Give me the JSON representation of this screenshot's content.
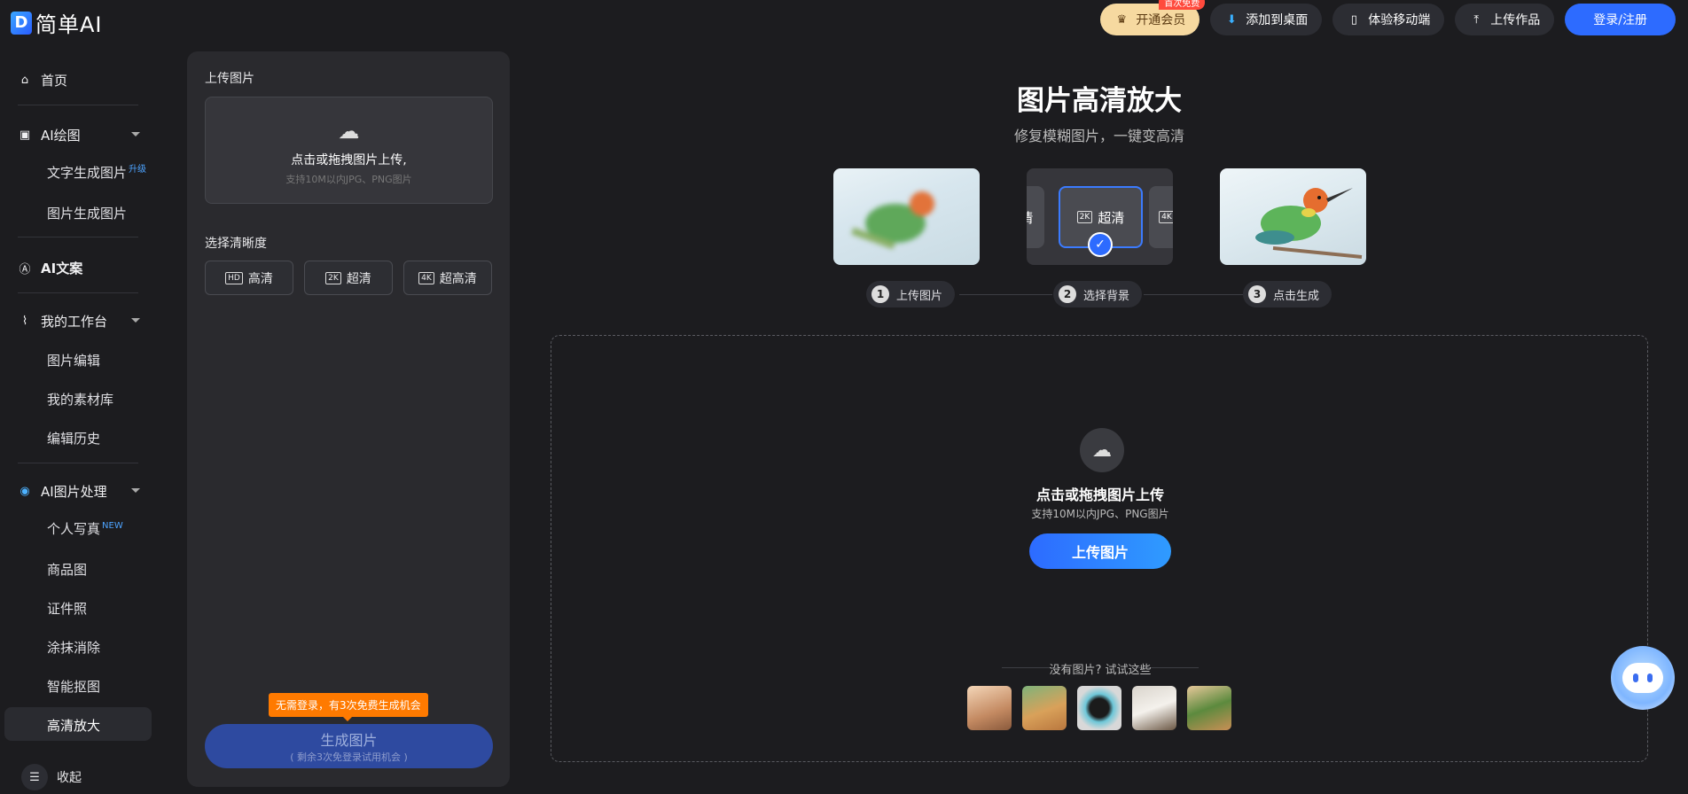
{
  "brand": {
    "logo_letter": "D",
    "name": "简单AI"
  },
  "top": {
    "vip": "开通会员",
    "vip_badge": "首次免费",
    "add_desktop": "添加到桌面",
    "mobile": "体验移动端",
    "upload_work": "上传作品",
    "login": "登录/注册"
  },
  "sidebar": {
    "home": "首页",
    "ai_draw": "AI绘图",
    "text_to_image": "文字生成图片",
    "text_to_image_tag": "升级",
    "image_to_image": "图片生成图片",
    "ai_copy": "AI文案",
    "workspace": "我的工作台",
    "image_edit": "图片编辑",
    "materials": "我的素材库",
    "history": "编辑历史",
    "ai_image_proc": "AI图片处理",
    "portrait": "个人写真",
    "portrait_tag": "NEW",
    "product": "商品图",
    "id_photo": "证件照",
    "erase": "涂抹消除",
    "cutout": "智能抠图",
    "upscale": "高清放大",
    "collapse": "收起"
  },
  "panel": {
    "upload_label": "上传图片",
    "upload_text": "点击或拖拽图片上传,",
    "upload_hint": "支持10M以内JPG、PNG图片",
    "res_label": "选择清晰度",
    "res_options": [
      {
        "tag": "HD",
        "label": "高清"
      },
      {
        "tag": "2K",
        "label": "超清"
      },
      {
        "tag": "4K",
        "label": "超高清"
      }
    ],
    "promo": "无需登录，有3次免费生成机会",
    "gen_label": "生成图片",
    "gen_sub": "( 剩余3次免登录试用机会 )"
  },
  "main": {
    "title": "图片高清放大",
    "subtitle": "修复模糊图片，一键变高清",
    "chip_left": "清",
    "chip_mid_tag": "2K",
    "chip_mid": "超清",
    "chip_right": "4K",
    "steps": [
      {
        "num": "1",
        "label": "上传图片"
      },
      {
        "num": "2",
        "label": "选择背景"
      },
      {
        "num": "3",
        "label": "点击生成"
      }
    ],
    "drop_title": "点击或拖拽图片上传",
    "drop_hint": "支持10M以内JPG、PNG图片",
    "drop_button": "上传图片",
    "try_label": "没有图片? 试试这些"
  },
  "colors": {
    "accent": "#2d6bff",
    "promo": "#ff7a00",
    "vip": "#f6d9a0"
  }
}
